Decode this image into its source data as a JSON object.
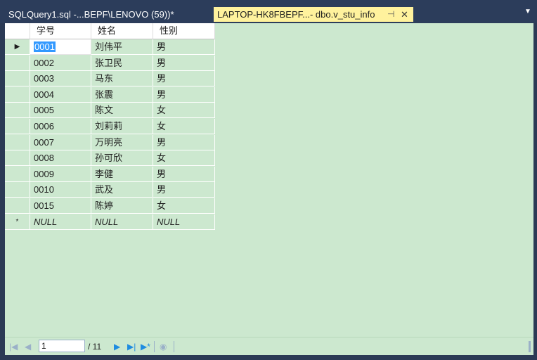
{
  "tabs": [
    {
      "label": "SQLQuery1.sql -...BEPF\\LENOVO (59))*",
      "active": false
    },
    {
      "label": "LAPTOP-HK8FBEPF...- dbo.v_stu_info",
      "active": true
    }
  ],
  "icons": {
    "pin": "⊣",
    "close": "✕",
    "overflow": "▼"
  },
  "grid": {
    "columns": [
      "学号",
      "姓名",
      "性别"
    ],
    "rows": [
      [
        "0001",
        "刘伟平",
        "男"
      ],
      [
        "0002",
        "张卫民",
        "男"
      ],
      [
        "0003",
        "马东",
        "男"
      ],
      [
        "0004",
        "张震",
        "男"
      ],
      [
        "0005",
        "陈文",
        "女"
      ],
      [
        "0006",
        "刘莉莉",
        "女"
      ],
      [
        "0007",
        "万明亮",
        "男"
      ],
      [
        "0008",
        "孙可欣",
        "女"
      ],
      [
        "0009",
        "李健",
        "男"
      ],
      [
        "0010",
        "武及",
        "男"
      ],
      [
        "0015",
        "陈婷",
        "女"
      ]
    ],
    "new_row": [
      "NULL",
      "NULL",
      "NULL"
    ],
    "current_row_marker": "▶",
    "new_row_marker": "*"
  },
  "navigator": {
    "current_record": "1",
    "total": "/ 11",
    "first": "|◀",
    "prev": "◀",
    "next": "▶",
    "last": "▶|",
    "new": "▶*",
    "stop": "◉"
  },
  "colors": {
    "grid_background": "#cce8cf",
    "active_tab": "#fff29d",
    "chrome": "#2c3d5b",
    "selection": "#3399ff"
  }
}
